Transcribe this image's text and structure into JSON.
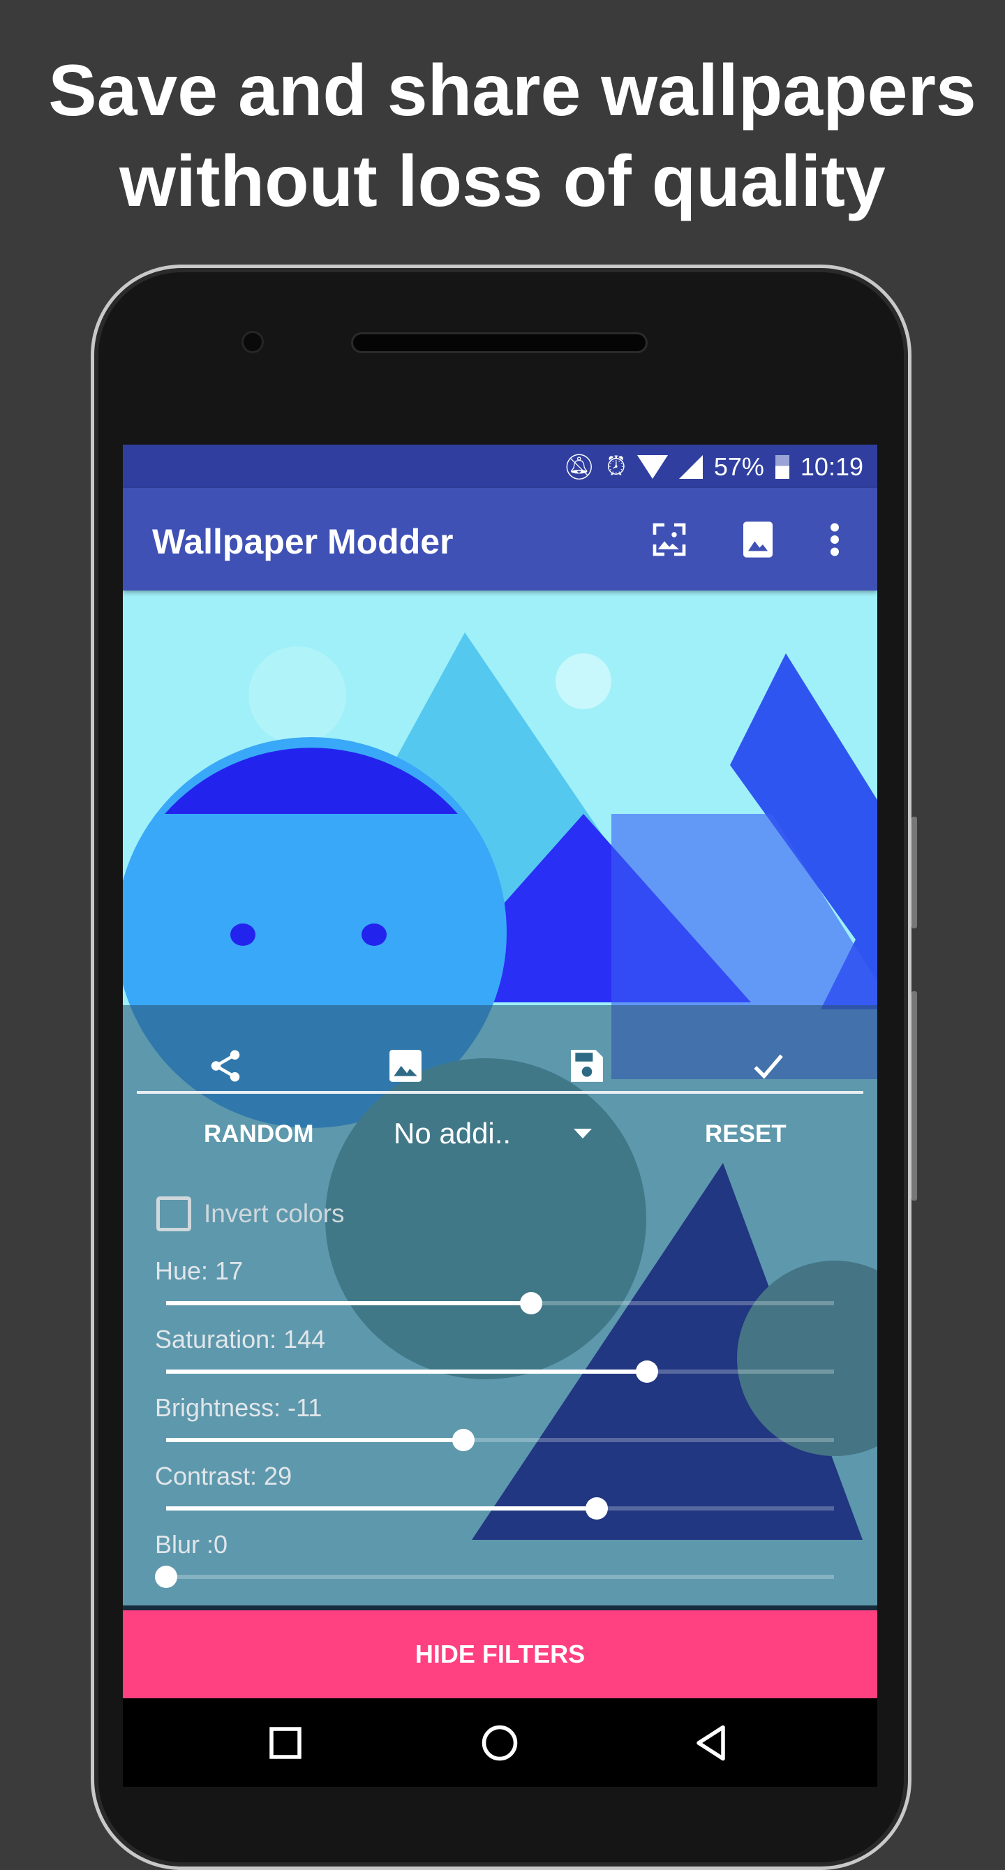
{
  "headline": {
    "line1": "Save and share wallpapers",
    "line2": "without loss of quality"
  },
  "status_bar": {
    "battery": "57%",
    "time": "10:19",
    "icons": [
      "notifications-off-icon",
      "alarm-icon",
      "wifi-icon",
      "signal-icon",
      "battery-icon"
    ]
  },
  "app_bar": {
    "title": "Wallpaper Modder",
    "actions": [
      "wallpaper-icon",
      "image-icon",
      "more-vert-icon"
    ]
  },
  "filter_panel": {
    "toolbar": [
      "share-icon",
      "image-icon",
      "save-icon",
      "check-icon"
    ],
    "random_label": "RANDOM",
    "effect_select": {
      "value": "No addi.."
    },
    "reset_label": "RESET",
    "invert": {
      "label": "Invert colors",
      "checked": false
    },
    "sliders": [
      {
        "label": "Hue: 17",
        "level": 0.547
      },
      {
        "label": "Saturation: 144",
        "level": 0.72
      },
      {
        "label": "Brightness: -11",
        "level": 0.445
      },
      {
        "label": "Contrast: 29",
        "level": 0.645
      },
      {
        "label": "Blur :0",
        "level": 0
      }
    ],
    "hide_label": "HIDE FILTERS"
  },
  "colors": {
    "primary": "#3f51b5",
    "primary_dark": "#303f9f",
    "accent": "#ff4081"
  }
}
